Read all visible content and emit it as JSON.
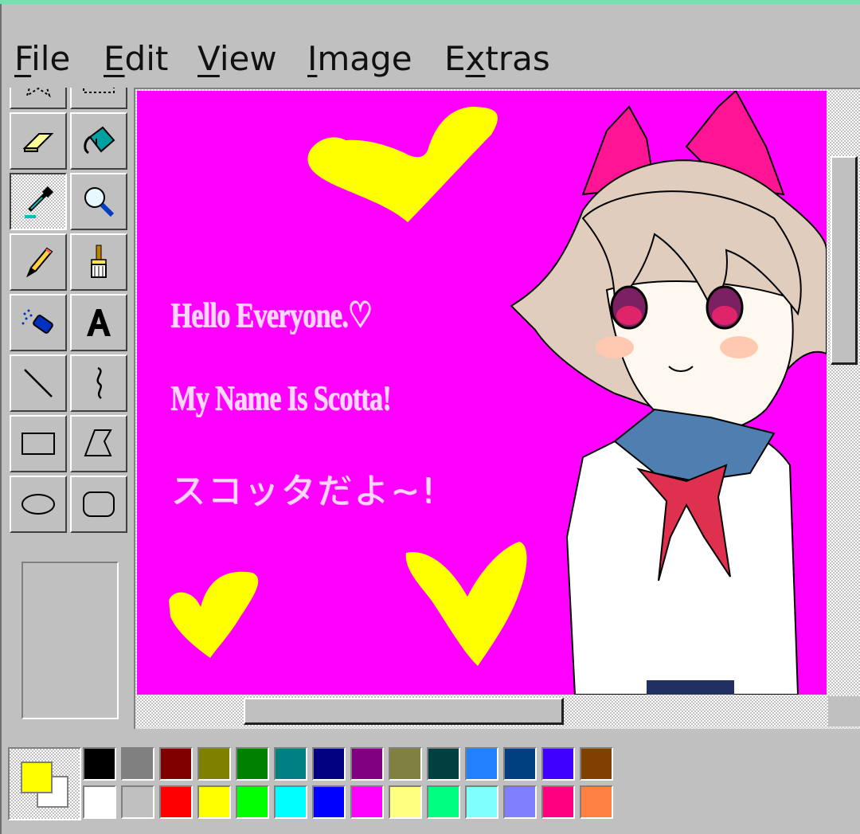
{
  "menu": {
    "items": [
      {
        "accel": "F",
        "rest": "ile",
        "pre": ""
      },
      {
        "accel": "E",
        "rest": "dit",
        "pre": ""
      },
      {
        "accel": "V",
        "rest": "iew",
        "pre": ""
      },
      {
        "accel": "I",
        "rest": "mage",
        "pre": ""
      },
      {
        "accel": "x",
        "rest": "tras",
        "pre": "E"
      }
    ]
  },
  "tools": [
    "free-form-select-icon",
    "rectangle-select-icon",
    "eraser-icon",
    "fill-bucket-icon",
    "color-picker-icon",
    "magnifier-icon",
    "pencil-icon",
    "brush-icon",
    "airbrush-icon",
    "text-icon",
    "line-icon",
    "curve-icon",
    "rectangle-icon",
    "polygon-icon",
    "ellipse-icon",
    "rounded-rectangle-icon"
  ],
  "active_tool": "color-picker-icon",
  "canvas": {
    "background": "#ff00ff",
    "line1": "Hello Everyone.♡",
    "line2": "My Name Is Scotta!",
    "line3": "スコッタだよ~!"
  },
  "palette": {
    "foreground": "#ffff00",
    "background": "#ffffff",
    "row1": [
      "#000000",
      "#808080",
      "#800000",
      "#808000",
      "#008000",
      "#008080",
      "#000080",
      "#800080",
      "#808040",
      "#004040",
      "#2080ff",
      "#004080",
      "#4000ff",
      "#804000"
    ],
    "row2": [
      "#ffffff",
      "#c0c0c0",
      "#ff0000",
      "#ffff00",
      "#00ff00",
      "#00ffff",
      "#0000ff",
      "#ff00ff",
      "#ffff80",
      "#00ff80",
      "#80ffff",
      "#8080ff",
      "#ff0080",
      "#ff8040"
    ]
  }
}
